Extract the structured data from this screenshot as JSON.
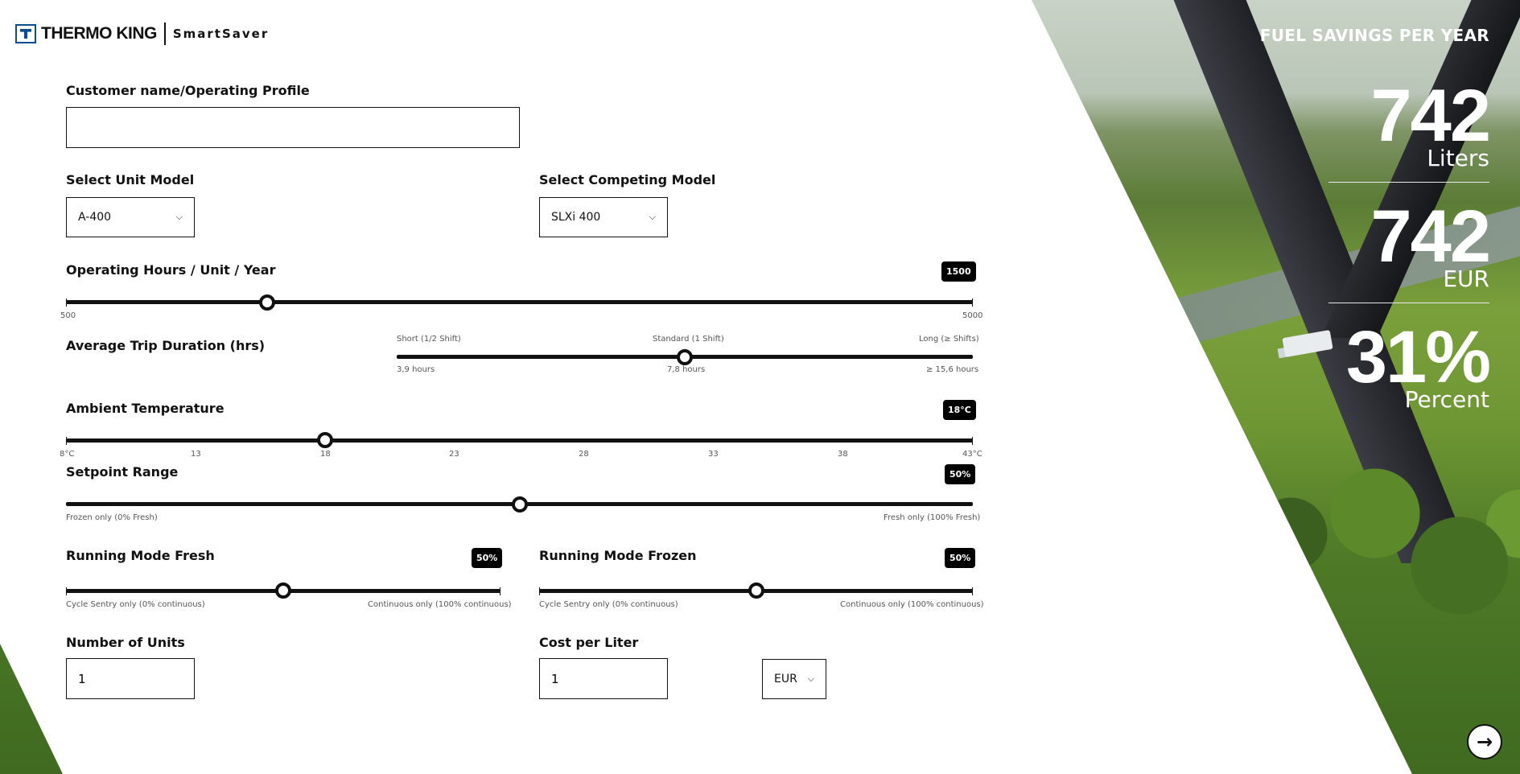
{
  "brand": {
    "name": "THERMO KING",
    "product": "SmartSaver"
  },
  "form": {
    "customer": {
      "label": "Customer name/Operating Profile",
      "value": "",
      "placeholder": ""
    },
    "unit_model": {
      "label": "Select Unit Model",
      "value": "A-400"
    },
    "competing_model": {
      "label": "Select Competing Model",
      "value": "SLXi 400"
    },
    "operating_hours": {
      "label": "Operating Hours / Unit / Year",
      "badge": "1500",
      "min_label": "500",
      "max_label": "5000",
      "value": 1500,
      "min": 500,
      "max": 5000
    },
    "trip_duration": {
      "label": "Average Trip Duration (hrs)",
      "top_labels": [
        "Short (1/2 Shift)",
        "Standard (1 Shift)",
        "Long (≥ Shifts)"
      ],
      "bottom_labels": [
        "3,9 hours",
        "7,8 hours",
        "≥ 15,6 hours"
      ],
      "selected_index": 1
    },
    "ambient_temp": {
      "label": "Ambient Temperature",
      "badge": "18°C",
      "value": 18,
      "min": 8,
      "max": 43,
      "ticks": [
        "8°C",
        "13",
        "18",
        "23",
        "28",
        "33",
        "38",
        "43°C"
      ]
    },
    "setpoint": {
      "label": "Setpoint Range",
      "badge": "50%",
      "value": 50,
      "min_label": "Frozen only (0% Fresh)",
      "max_label": "Fresh only (100% Fresh)"
    },
    "mode_fresh": {
      "label": "Running Mode Fresh",
      "badge": "50%",
      "value": 50,
      "min_label": "Cycle Sentry only (0% continuous)",
      "max_label": "Continuous only (100% continuous)"
    },
    "mode_frozen": {
      "label": "Running Mode Frozen",
      "badge": "50%",
      "value": 50,
      "min_label": "Cycle Sentry only (0% continuous)",
      "max_label": "Continuous only (100% continuous)"
    },
    "units": {
      "label": "Number of Units",
      "value": "1"
    },
    "cost": {
      "label": "Cost per Liter",
      "value": "1"
    },
    "currency": {
      "value": "EUR"
    }
  },
  "results": {
    "title": "FUEL SAVINGS PER YEAR",
    "liters": {
      "value": "742",
      "unit": "Liters"
    },
    "currency": {
      "value": "742",
      "unit": "EUR"
    },
    "percent": {
      "value": "31%",
      "unit": "Percent"
    }
  },
  "icons": {
    "next": "arrow-right-icon",
    "dropdown": "chevron-down-icon"
  },
  "colors": {
    "brand_blue": "#0a4d91",
    "accent": "#000000"
  }
}
